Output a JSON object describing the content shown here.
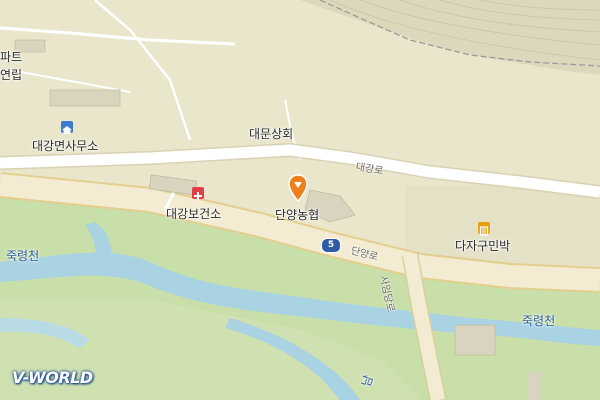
{
  "map": {
    "labels": {
      "apartment_fragment_1": "파트",
      "apartment_fragment_2": "연립",
      "office": "대강면사무소",
      "landmark": "대문상회",
      "health_center": "대강보건소",
      "nonghyup": "단양농협",
      "guesthouse": "다자구민박",
      "river_left": "죽령천",
      "river_right": "죽령천",
      "road_daegang": "대강로",
      "road_danyang": "단양로",
      "road_saimdang": "사임당로",
      "bottom_partial": "남"
    },
    "route_number": "5",
    "brand": "V-WORLD",
    "icons": {
      "office": "office-icon",
      "hospital": "hospital-icon",
      "lodging": "lodging-icon",
      "location_marker": "location-marker-icon",
      "apartment": "apartment-icon"
    },
    "colors": {
      "land": "#e9e6cc",
      "green": "#c9dfa9",
      "water": "#a9d3e3",
      "road_main": "#f3ecd2",
      "road_minor": "#ffffff",
      "marker": "#ef7f1a",
      "route_shield": "#2d5aa6",
      "hospital": "#e0404a",
      "lodging": "#e5a10c",
      "office": "#3d7bd0"
    }
  }
}
